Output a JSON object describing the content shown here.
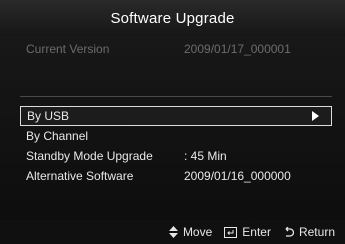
{
  "title": "Software Upgrade",
  "current_version": {
    "label": "Current Version",
    "value": "2009/01/17_000001"
  },
  "menu": [
    {
      "label": "By USB",
      "value": ""
    },
    {
      "label": "By Channel",
      "value": ""
    },
    {
      "label": "Standby Mode Upgrade",
      "value": ": 45 Min"
    },
    {
      "label": "Alternative Software",
      "value": "2009/01/16_000000"
    }
  ],
  "selected_index": 0,
  "footer": {
    "move": "Move",
    "enter": "Enter",
    "return": "Return"
  },
  "colors": {
    "background": "#0c0c0c",
    "text": "#e8e8e8",
    "dim_text": "#6c6c6c",
    "highlight_border": "#dcdcdc"
  }
}
